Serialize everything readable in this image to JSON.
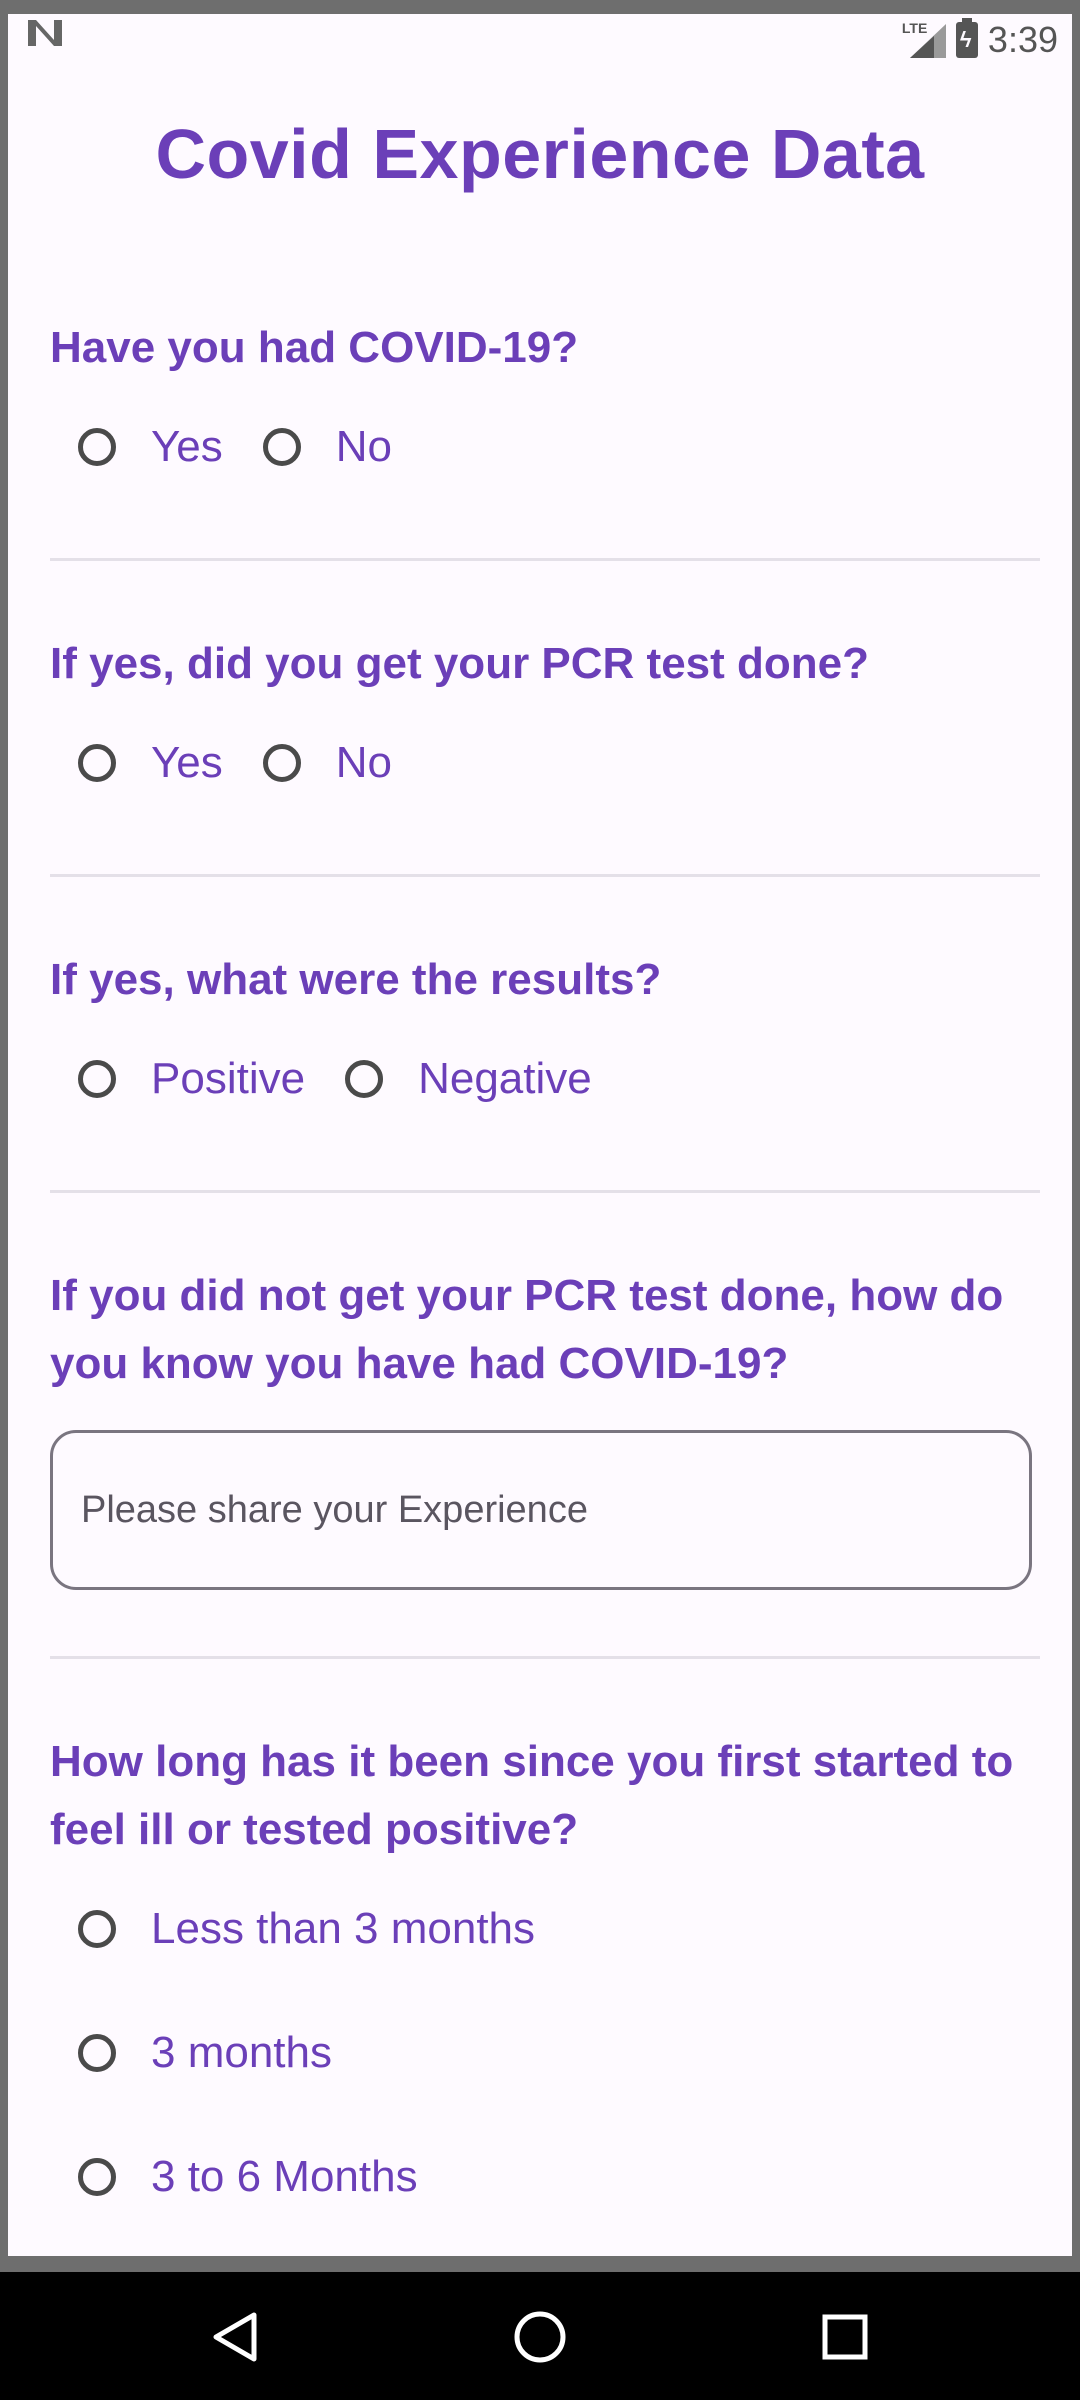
{
  "status_bar": {
    "network": "LTE",
    "time": "3:39"
  },
  "title": "Covid Experience Data",
  "questions": {
    "q1": {
      "text": "Have you had COVID-19?",
      "options": [
        "Yes",
        "No"
      ]
    },
    "q2": {
      "text": "If yes, did you get your PCR test done?",
      "options": [
        "Yes",
        "No"
      ]
    },
    "q3": {
      "text": "If yes, what were the results?",
      "options": [
        "Positive",
        "Negative"
      ]
    },
    "q4": {
      "text": "If you did not get your PCR test done, how do you know you have had COVID-19?",
      "placeholder": "Please share your Experience"
    },
    "q5": {
      "text": "How long has it been since you first started to feel ill or tested positive?",
      "options": [
        "Less than 3 months",
        "3 months",
        "3 to 6 Months"
      ]
    }
  },
  "colors": {
    "accent": "#6b3fb8",
    "background": "#fefaff",
    "divider": "#e4e0e8"
  },
  "icons": {
    "nav": [
      "back-icon",
      "home-icon",
      "recents-icon"
    ]
  }
}
